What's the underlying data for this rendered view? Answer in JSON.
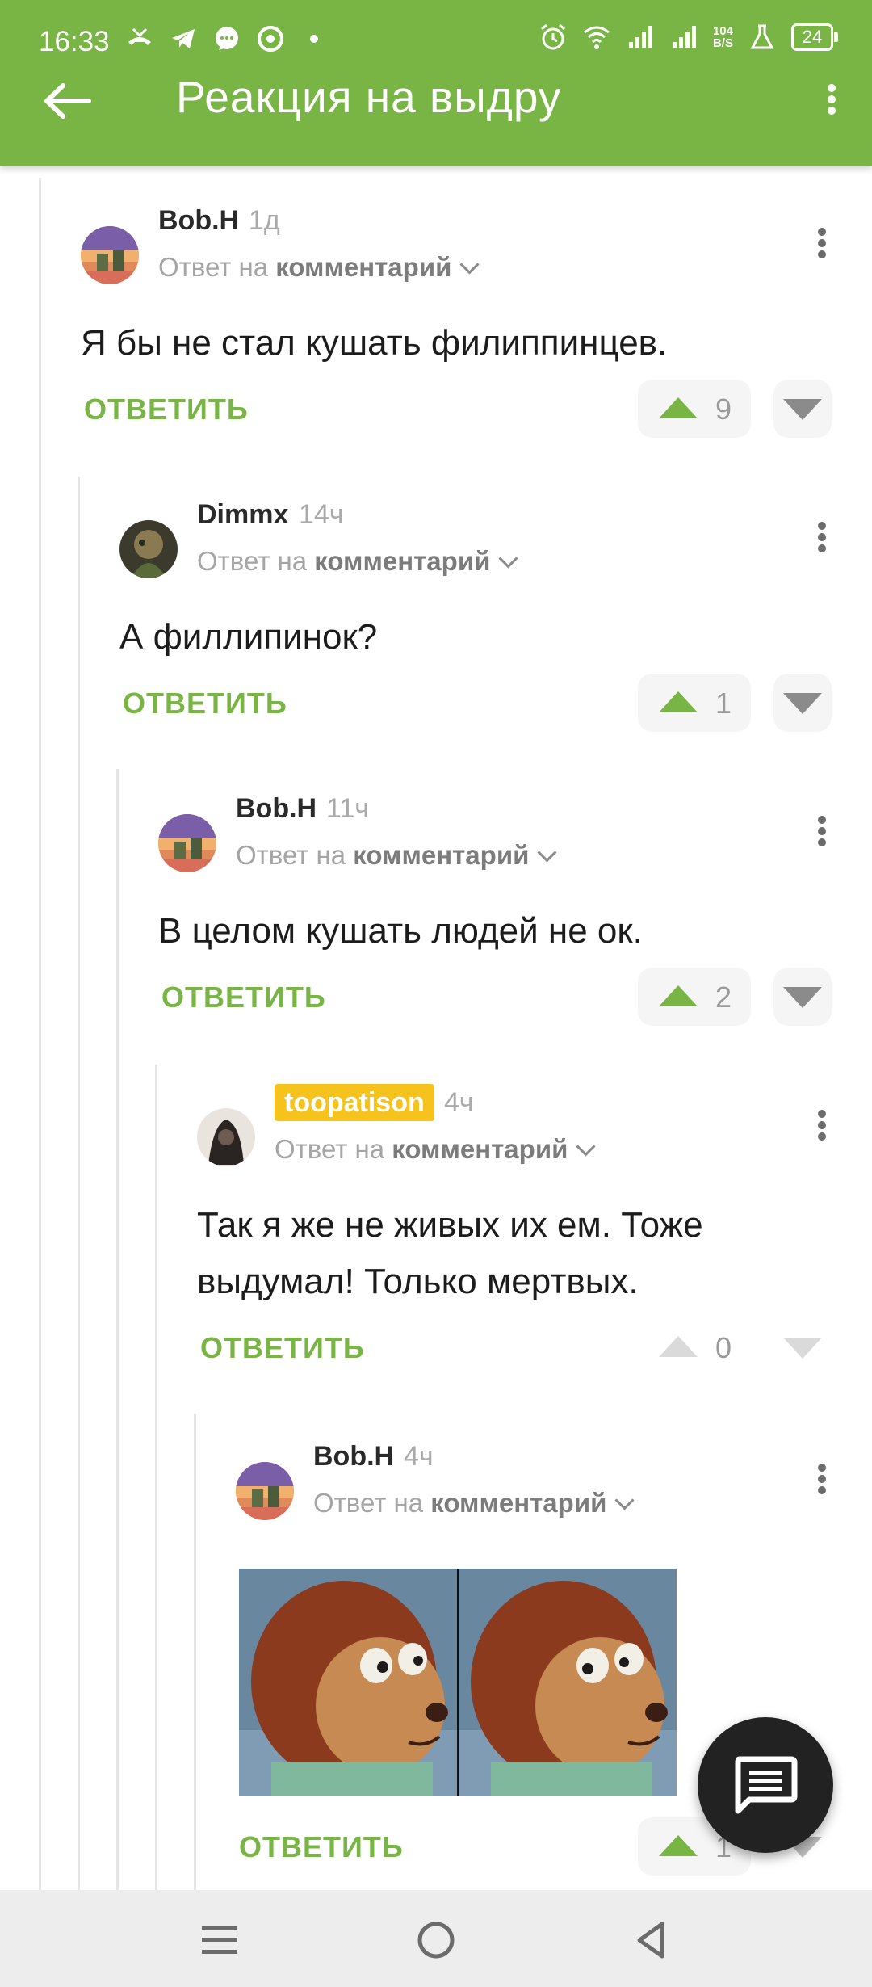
{
  "status_bar": {
    "time": "16:33",
    "net_speed_value": "104",
    "net_speed_unit": "B/S",
    "battery": "24"
  },
  "toolbar": {
    "title": "Реакция на выдру"
  },
  "comments": [
    {
      "user": "Bob.H",
      "time": "1д",
      "reply_prefix": "Ответ на",
      "reply_target": "комментарий",
      "text": "Я бы не стал кушать филиппинцев.",
      "reply_label": "ОТВЕТИТЬ",
      "score": "9"
    },
    {
      "user": "Dimmx",
      "time": "14ч",
      "reply_prefix": "Ответ на",
      "reply_target": "комментарий",
      "text": "А филлипинок?",
      "reply_label": "ОТВЕТИТЬ",
      "score": "1"
    },
    {
      "user": "Bob.H",
      "time": "11ч",
      "reply_prefix": "Ответ на",
      "reply_target": "комментарий",
      "text": "В целом кушать людей не ок.",
      "reply_label": "ОТВЕТИТЬ",
      "score": "2"
    },
    {
      "user": "toopatison",
      "time": "4ч",
      "reply_prefix": "Ответ на",
      "reply_target": "комментарий",
      "text_line1": "Так я же не живых их ем. Тоже",
      "text_line2": "выдумал! Только мертвых.",
      "reply_label": "ОТВЕТИТЬ",
      "score": "0"
    },
    {
      "user": "Bob.H",
      "time": "4ч",
      "reply_prefix": "Ответ на",
      "reply_target": "комментарий",
      "reply_label": "ОТВЕТИТЬ",
      "score": "1"
    }
  ],
  "colors": {
    "accent": "#79b544",
    "badge": "#f6c31c",
    "fab": "#222222"
  },
  "icons": {
    "back": "arrow-left-icon",
    "menu": "more-vert-icon",
    "fab": "comment-icon",
    "nav": [
      "menu-icon",
      "home-circle-icon",
      "back-triangle-icon"
    ]
  }
}
